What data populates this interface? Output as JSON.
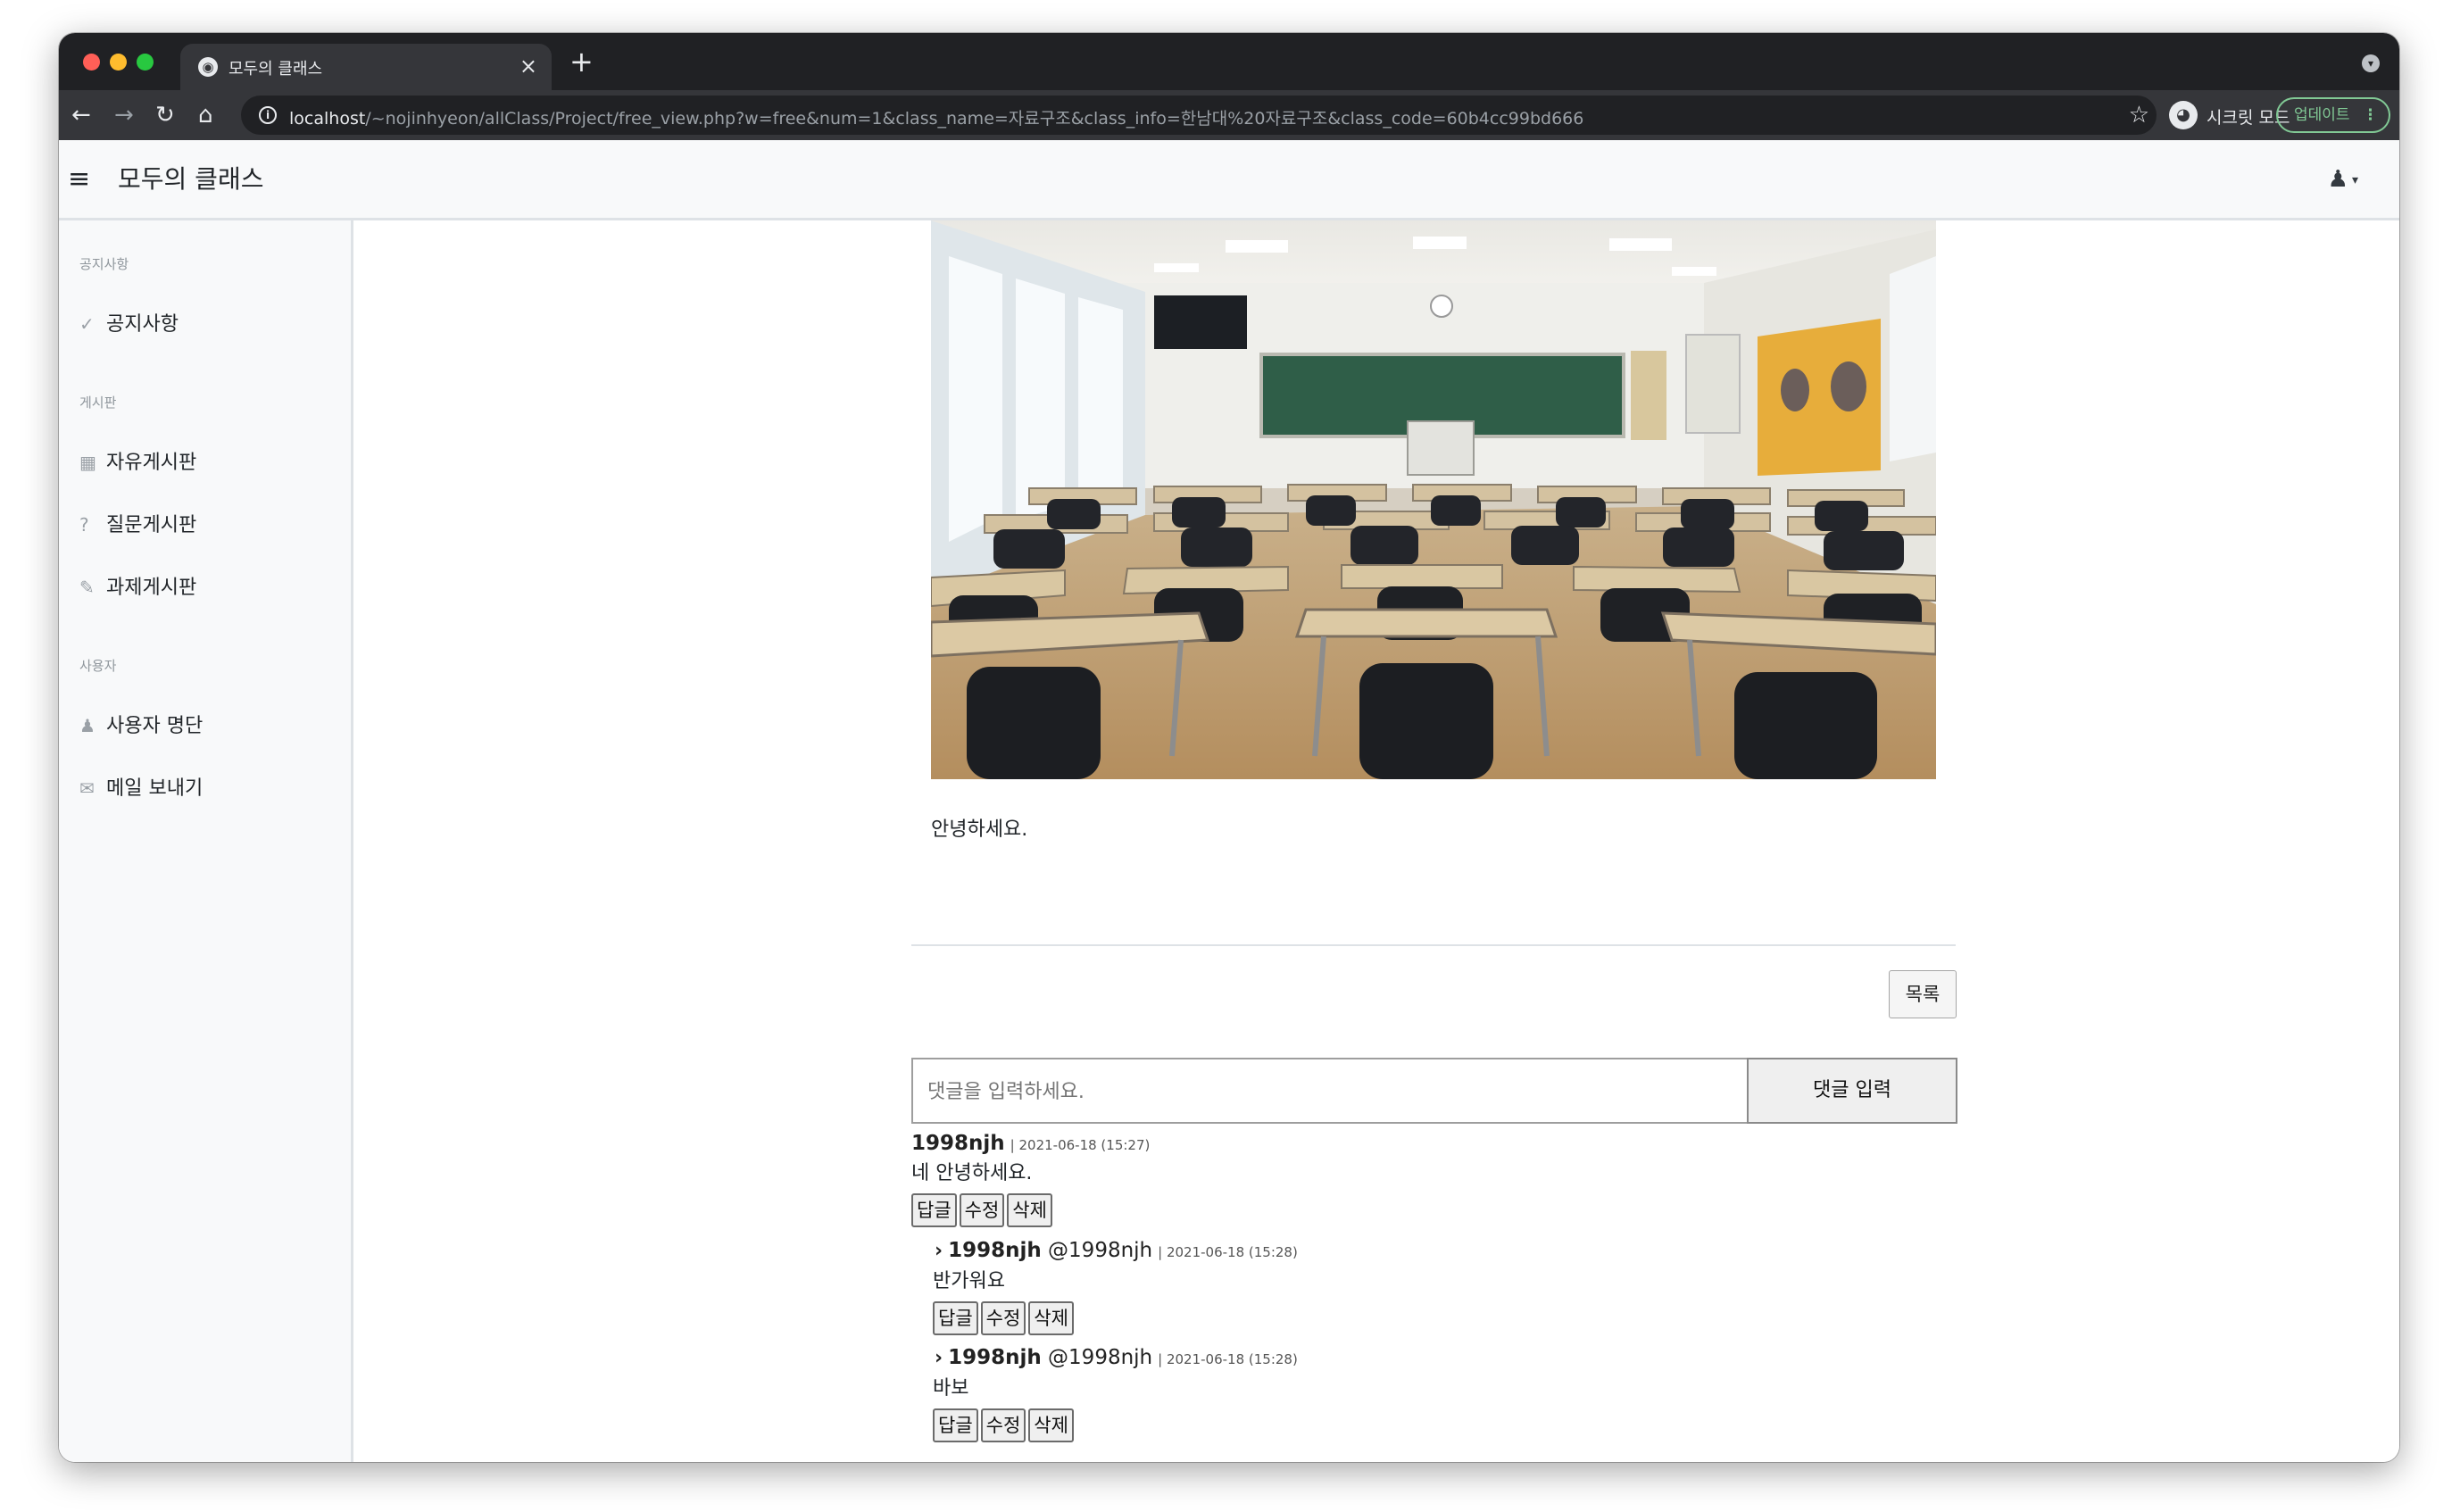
{
  "browser": {
    "tab_title": "모두의 클래스",
    "tab_close": "×",
    "new_tab": "+",
    "url_host": "localhost",
    "url_path": "/~nojinhyeon/allClass/Project/free_view.php?w=free&num=1&class_name=자료구조&class_info=한남대%20자료구조&class_code=60b4cc99bd666",
    "profile_label": "시크릿 모드",
    "update_label": "업데이트",
    "icons": [
      "back-icon",
      "forward-icon",
      "reload-icon",
      "home-icon",
      "info-icon",
      "star-icon",
      "incognito-icon",
      "more-icon"
    ]
  },
  "navbar": {
    "brand": "모두의 클래스",
    "hamburger": "≡",
    "user_icon": "👤",
    "caret": "▾"
  },
  "sidebar": {
    "sections": [
      {
        "heading": "공지사항",
        "items": [
          {
            "icon": "check-icon",
            "glyph": "✓",
            "label": "공지사항"
          }
        ]
      },
      {
        "heading": "게시판",
        "items": [
          {
            "icon": "table-icon",
            "glyph": "▦",
            "label": "자유게시판"
          },
          {
            "icon": "question-icon",
            "glyph": "?",
            "label": "질문게시판"
          },
          {
            "icon": "pencil-icon",
            "glyph": "✎",
            "label": "과제게시판"
          }
        ]
      },
      {
        "heading": "사용자",
        "items": [
          {
            "icon": "user-icon",
            "glyph": "👤",
            "label": "사용자 명단"
          },
          {
            "icon": "envelope-icon",
            "glyph": "✉",
            "label": "메일 보내기"
          }
        ]
      }
    ]
  },
  "post": {
    "body": "안녕하세요.",
    "list_button": "목록"
  },
  "comment_form": {
    "placeholder": "댓글을 입력하세요.",
    "submit_label": "댓글 입력"
  },
  "comments": [
    {
      "author": "1998njh",
      "mention": "",
      "date": "| 2021-06-18 (15:27)",
      "text": "네 안녕하세요.",
      "reply": false
    },
    {
      "author": "1998njh",
      "mention": "@1998njh",
      "date": "| 2021-06-18 (15:28)",
      "text": "반가워요",
      "reply": true
    },
    {
      "author": "1998njh",
      "mention": "@1998njh",
      "date": "| 2021-06-18 (15:28)",
      "text": "바보",
      "reply": true
    }
  ],
  "comment_actions": {
    "reply": "답글",
    "edit": "수정",
    "delete": "삭제"
  },
  "colors": {
    "accent_update": "#81c995",
    "chrome_dark": "#202124",
    "chrome_toolbar": "#35363a",
    "sidebar_bg": "#f8f9fa"
  }
}
